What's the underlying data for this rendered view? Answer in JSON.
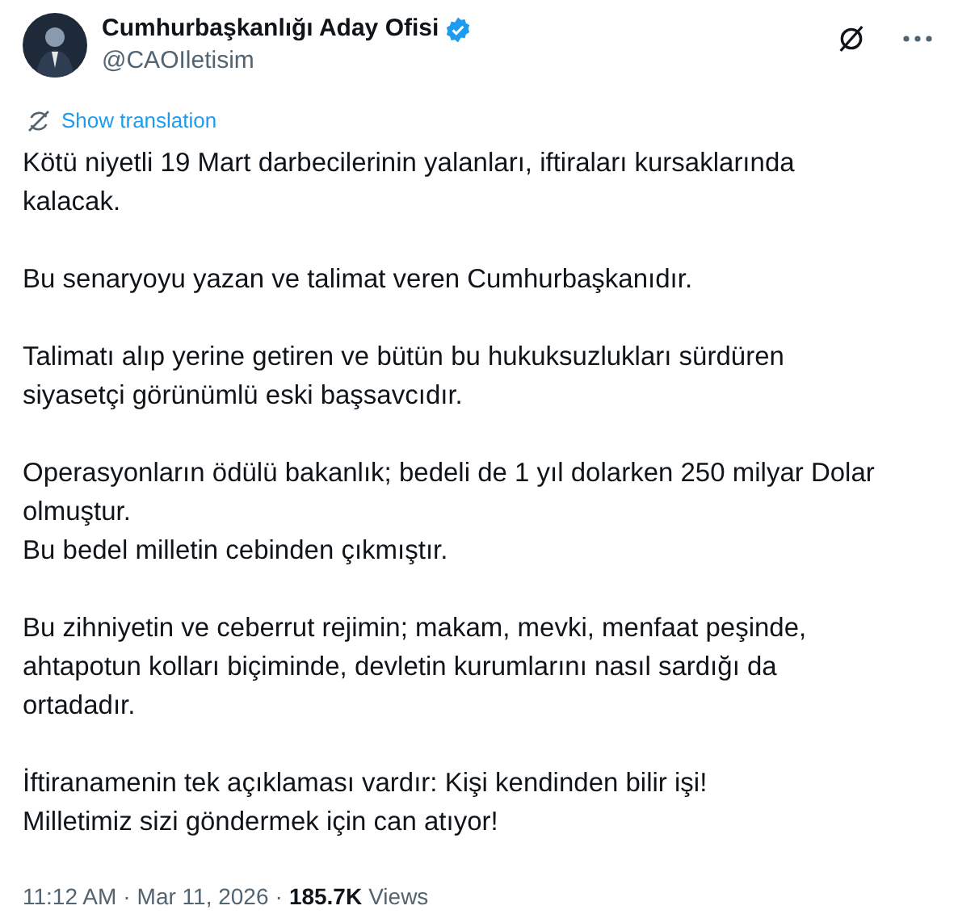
{
  "author": {
    "name": "Cumhurbaşkanlığı Aday Ofisi",
    "verified": true,
    "handle": "@CAOIletisim"
  },
  "translate_link": "Show translation",
  "paragraphs": [
    [
      "Kötü niyetli 19 Mart darbecilerinin yalanları, iftiraları kursaklarında",
      "kalacak."
    ],
    [
      "Bu senaryoyu yazan ve talimat veren Cumhurbaşkanıdır."
    ],
    [
      "Talimatı alıp yerine getiren ve bütün bu hukuksuzlukları sürdüren",
      "siyasetçi görünümlü eski başsavcıdır."
    ],
    [
      "Operasyonların ödülü bakanlık; bedeli de 1 yıl dolarken 250 milyar Dolar",
      "olmuştur.",
      "Bu bedel milletin cebinden çıkmıştır."
    ],
    [
      "Bu zihniyetin ve ceberrut rejimin; makam, mevki, menfaat peşinde,",
      "ahtapotun kolları biçiminde, devletin kurumlarını nasıl sardığı da",
      "ortadadır."
    ],
    [
      "İftiranamenin tek açıklaması vardır: Kişi kendinden bilir işi!",
      "Milletimiz sizi göndermek için can atıyor!"
    ]
  ],
  "footer": {
    "time": "11:12 AM",
    "separator_1": "·",
    "date": "Mar 11, 2026",
    "separator_2": "·",
    "views_count": "185.7K",
    "views_label": "Views"
  }
}
